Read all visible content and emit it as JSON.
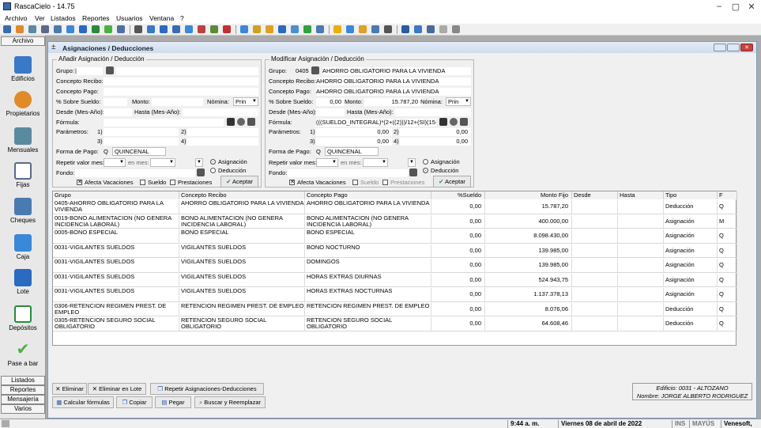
{
  "app": {
    "title": "RascaCielo - 14.75"
  },
  "menu": [
    "Archivo",
    "Ver",
    "Listados",
    "Reportes",
    "Usuarios",
    "Ventana",
    "?"
  ],
  "sidebar": {
    "top": "Archivo",
    "items": [
      {
        "label": "Edificios",
        "icon": "buildings-icon",
        "color": "#3a78c8"
      },
      {
        "label": "Propietarios",
        "icon": "people-icon",
        "color": "#e08a2a"
      },
      {
        "label": "Mensuales",
        "icon": "calendar-icon",
        "color": "#5a8aa0"
      },
      {
        "label": "Fijas",
        "icon": "document-icon",
        "color": "#5a6a8a"
      },
      {
        "label": "Cheques",
        "icon": "pen-icon",
        "color": "#4a7ab0"
      },
      {
        "label": "Caja",
        "icon": "monitor-icon",
        "color": "#3a88d8"
      },
      {
        "label": "Lote",
        "icon": "stack-icon",
        "color": "#2a6ac0"
      },
      {
        "label": "Depósitos",
        "icon": "checkbox-icon",
        "color": "#2a8a3a"
      },
      {
        "label": "Pase a bar",
        "icon": "checkmark-icon",
        "color": "#4ab040"
      }
    ],
    "bottom": [
      "Listados",
      "Reportes",
      "Mensajería",
      "Varios"
    ]
  },
  "window": {
    "title": "Asignaciones / Deducciones"
  },
  "add": {
    "title": "Añadir Asignación / Deducción",
    "grupo_label": "Grupo:",
    "concepto_recibo_label": "Concepto Recibo:",
    "concepto_pago_label": "Concepto Pago:",
    "sobre_sueldo_label": "% Sobre Sueldo:",
    "monto_label": "Monto:",
    "nomina_label": "Nómina:",
    "nomina_value": "Prin",
    "desde_label": "Desde (Mes-Año):",
    "hasta_label": "Hasta (Mes-Año):",
    "formula_label": "Fórmula:",
    "parametros_label": "Parámetros:",
    "p1": "1)",
    "p2": "2)",
    "p3": "3)",
    "p4": "4)",
    "forma_pago_label": "Forma de Pago:",
    "forma_pago_code": "Q",
    "forma_pago_value": "QUINCENAL",
    "repetir_label": "Repetir valor mes:",
    "en_mes_label": "en mes:",
    "fondo_label": "Fondo:",
    "radio_asignacion": "Asignación",
    "radio_deduccion": "Deducción",
    "afecta_vacaciones": "Afecta Vacaciones",
    "sueldo": "Sueldo",
    "prestaciones": "Prestaciones",
    "aceptar": "Aceptar"
  },
  "mod": {
    "title": "Modificar Asignación / Deducción",
    "grupo_label": "Grupo:",
    "grupo_code": "0405",
    "grupo_value": "AHORRO OBLIGATORIO PARA LA VIVIENDA",
    "concepto_recibo_label": "Concepto Recibo:",
    "concepto_recibo_value": "AHORRO OBLIGATORIO PARA LA VIVIENDA",
    "concepto_pago_label": "Concepto Pago:",
    "concepto_pago_value": "AHORRO OBLIGATORIO PARA LA VIVIENDA",
    "sobre_sueldo_label": "% Sobre Sueldo:",
    "sobre_sueldo_value": "0,00",
    "monto_label": "Monto:",
    "monto_value": "15.787,20",
    "nomina_label": "Nómina:",
    "nomina_value": "Prin",
    "desde_label": "Desde (Mes-Año):",
    "hasta_label": "Hasta (Mes-Año):",
    "formula_label": "Fórmula:",
    "formula_value": "(((SUELDO_INTEGRAL)*(2+((2)))/12+(SI)(15+(",
    "parametros_label": "Parámetros:",
    "p1": "1)",
    "p1v": "0,00",
    "p2": "2)",
    "p2v": "0,00",
    "p3": "3)",
    "p3v": "0,00",
    "p4": "4)",
    "p4v": "0,00",
    "forma_pago_label": "Forma de Pago:",
    "forma_pago_code": "Q",
    "forma_pago_value": "QUINCENAL",
    "repetir_label": "Repetir valor mes:",
    "en_mes_label": "en mes:",
    "fondo_label": "Fondo:",
    "radio_asignacion": "Asignación",
    "radio_deduccion": "Deducción",
    "afecta_vacaciones": "Afecta Vacaciones",
    "sueldo": "Sueldo",
    "prestaciones": "Prestaciones",
    "aceptar": "Aceptar"
  },
  "grid": {
    "columns": [
      "Grupo",
      "Concepto Recibo",
      "Concepto Pago",
      "%Sueldo",
      "Monto Fijo",
      "Desde",
      "Hasta",
      "Tipo",
      "F"
    ],
    "rows": [
      [
        "0405-AHORRO OBLIGATORIO PARA LA VIVIENDA",
        "AHORRO OBLIGATORIO PARA LA VIVIENDA",
        "AHORRO OBLIGATORIO PARA LA VIVIENDA",
        "0,00",
        "15.787,20",
        "",
        "",
        "Deducción",
        "Q"
      ],
      [
        "0019-BONO ALIMENTACION (NO GENERA INCIDENCIA LABORAL)",
        "BONO ALIMENTACION (NO GENERA INCIDENCIA LABORAL)",
        "BONO ALIMENTACION (NO GENERA INCIDENCIA LABORAL)",
        "0,00",
        "400.000,00",
        "",
        "",
        "Asignación",
        "M"
      ],
      [
        "0005-BONO ESPECIAL",
        "BONO ESPECIAL",
        "BONO ESPECIAL",
        "0,00",
        "8.098.430,00",
        "",
        "",
        "Asignación",
        "Q"
      ],
      [
        "0031-VIGILANTES SUELDOS",
        "VIGILANTES SUELDOS",
        "BONO NOCTURNO",
        "0,00",
        "139.985,00",
        "",
        "",
        "Asignación",
        "Q"
      ],
      [
        "0031-VIGILANTES SUELDOS",
        "VIGILANTES SUELDOS",
        "DOMINGOS",
        "0,00",
        "139.985,00",
        "",
        "",
        "Asignación",
        "Q"
      ],
      [
        "0031-VIGILANTES SUELDOS",
        "VIGILANTES SUELDOS",
        "HORAS EXTRAS DIURNAS",
        "0,00",
        "524.943,75",
        "",
        "",
        "Asignación",
        "Q"
      ],
      [
        "0031-VIGILANTES SUELDOS",
        "VIGILANTES SUELDOS",
        "HORAS EXTRAS NOCTURNAS",
        "0,00",
        "1.137.378,13",
        "",
        "",
        "Asignación",
        "Q"
      ],
      [
        "0306-RETENCION REGIMEN PREST. DE EMPLEO",
        "RETENCION REGIMEN PREST. DE EMPLEO",
        "RETENCION REGIMEN PREST. DE EMPLEO",
        "0,00",
        "8.076,06",
        "",
        "",
        "Deducción",
        "Q"
      ],
      [
        "0305-RETENCION SEGURO SOCIAL OBLIGATORIO",
        "RETENCION SEGURO SOCIAL OBLIGATORIO",
        "RETENCION SEGURO SOCIAL OBLIGATORIO",
        "0,00",
        "64.608,46",
        "",
        "",
        "Deducción",
        "Q"
      ]
    ]
  },
  "actions": {
    "eliminar": "Eliminar",
    "eliminar_lote": "Eliminar en Lote",
    "repetir": "Repetir Asignaciones-Deducciones",
    "calcular": "Calcular fórmulas",
    "copiar": "Copiar",
    "pegar": "Pegar",
    "buscar": "Buscar y Reemplazar"
  },
  "info": {
    "edificio": "Edificio: 0031 - ALTOZANO",
    "nombre": "Nombre: JORGE ALBERTO RODRIGUEZ"
  },
  "status": {
    "time": "9:44 a. m.",
    "date": "Viernes 08 de abril de 2022",
    "ins": "INS",
    "mayus": "MAYÚS",
    "company": "Venesoft, c.a."
  }
}
